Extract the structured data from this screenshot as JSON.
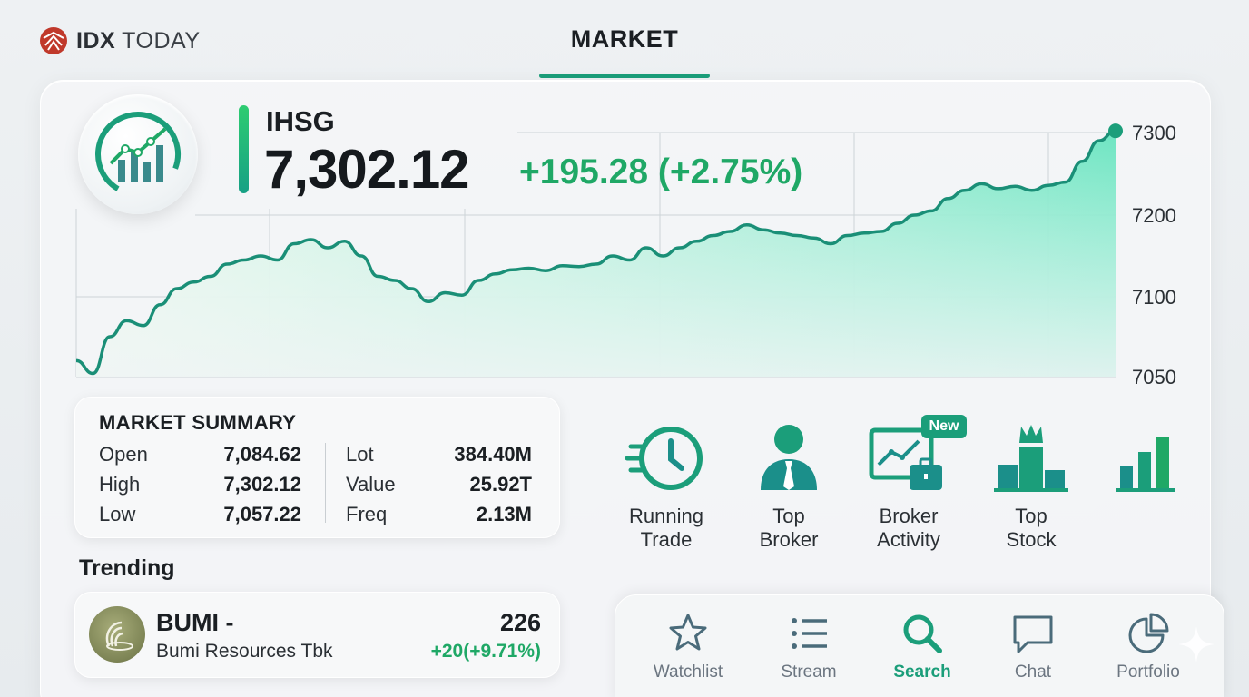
{
  "brand": {
    "name_bold": "IDX",
    "name_rest": " TODAY"
  },
  "header": {
    "active_tab": "MARKET"
  },
  "index": {
    "name": "IHSG",
    "value": "7,302.12",
    "change": "+195.28 (+2.75%)"
  },
  "chart_data": {
    "type": "area",
    "title": "",
    "xlabel": "",
    "ylabel": "",
    "y_ticks": [
      "7300",
      "7200",
      "7100",
      "7050"
    ],
    "grid": true,
    "series": [
      {
        "values": [
          7060,
          7052,
          7075,
          7085,
          7082,
          7095,
          7110,
          7118,
          7125,
          7140,
          7145,
          7150,
          7145,
          7165,
          7170,
          7160,
          7168,
          7150,
          7125,
          7120,
          7110,
          7097,
          7105,
          7102,
          7120,
          7128,
          7133,
          7135,
          7132,
          7138,
          7137,
          7140,
          7150,
          7145,
          7160,
          7150,
          7160,
          7168,
          7175,
          7180,
          7188,
          7182,
          7178,
          7175,
          7172,
          7165,
          7175,
          7178,
          7180,
          7190,
          7200,
          7205,
          7220,
          7230,
          7238,
          7232,
          7235,
          7230,
          7236,
          7240,
          7265,
          7290,
          7302
        ]
      }
    ],
    "colors": {
      "line": "#1a8f77",
      "fill_top": "#5fe3bc",
      "fill_bottom": "#e8f6ee",
      "end_dot": "#1b9e7a"
    }
  },
  "summary": {
    "title": "MARKET SUMMARY",
    "left": [
      {
        "label": "Open",
        "value": "7,084.62"
      },
      {
        "label": "High",
        "value": "7,302.12"
      },
      {
        "label": "Low",
        "value": "7,057.22"
      }
    ],
    "right": [
      {
        "label": "Lot",
        "value": "384.40M"
      },
      {
        "label": "Value",
        "value": "25.92T"
      },
      {
        "label": "Freq",
        "value": "2.13M"
      }
    ]
  },
  "trending": {
    "label": "Trending",
    "item": {
      "code": "BUMI -",
      "name": "Bumi Resources Tbk",
      "price": "226",
      "change": "+20(+9.71%)"
    }
  },
  "features": [
    {
      "line1": "Running",
      "line2": "Trade",
      "icon": "clock-speed-icon"
    },
    {
      "line1": "Top",
      "line2": "Broker",
      "icon": "broker-person-icon"
    },
    {
      "line1": "Broker",
      "line2": "Activity",
      "icon": "broker-activity-icon",
      "badge": "New"
    },
    {
      "line1": "Top",
      "line2": "Stock",
      "icon": "crown-podium-icon"
    },
    {
      "line1": "",
      "line2": "",
      "icon": "bar-chart-icon"
    }
  ],
  "nav": {
    "items": [
      {
        "label": "Watchlist",
        "icon": "star-icon"
      },
      {
        "label": "Stream",
        "icon": "list-icon"
      },
      {
        "label": "Search",
        "icon": "search-icon",
        "active": true
      },
      {
        "label": "Chat",
        "icon": "chat-icon"
      },
      {
        "label": "Portfolio",
        "icon": "pie-chart-icon"
      }
    ]
  },
  "colors": {
    "accent": "#1b9e7a",
    "positive": "#1fa866"
  }
}
